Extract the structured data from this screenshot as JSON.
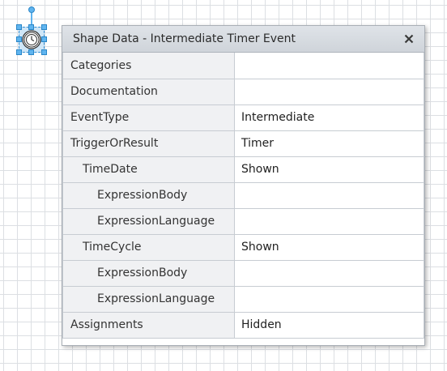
{
  "window": {
    "title": "Shape Data - Intermediate Timer Event",
    "close_label": "×"
  },
  "canvas": {
    "selected_shape_icon": "timer-event-icon",
    "grid_color": "#dcdfe3",
    "selection_color": "#2f8fd6"
  },
  "rows": [
    {
      "name": "Categories",
      "value": "",
      "indent": 0
    },
    {
      "name": "Documentation",
      "value": "",
      "indent": 0
    },
    {
      "name": "EventType",
      "value": "Intermediate",
      "indent": 0
    },
    {
      "name": "TriggerOrResult",
      "value": "Timer",
      "indent": 0
    },
    {
      "name": "TimeDate",
      "value": "Shown",
      "indent": 1
    },
    {
      "name": "ExpressionBody",
      "value": "",
      "indent": 2
    },
    {
      "name": "ExpressionLanguage",
      "value": "",
      "indent": 2
    },
    {
      "name": "TimeCycle",
      "value": "Shown",
      "indent": 1
    },
    {
      "name": "ExpressionBody",
      "value": "",
      "indent": 2
    },
    {
      "name": "ExpressionLanguage",
      "value": "",
      "indent": 2
    },
    {
      "name": "Assignments",
      "value": "Hidden",
      "indent": 0
    }
  ]
}
